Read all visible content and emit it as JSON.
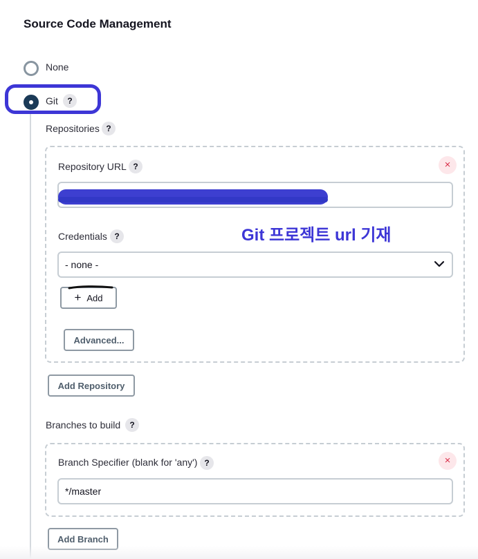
{
  "section": {
    "title": "Source Code Management"
  },
  "scm_options": {
    "none_label": "None",
    "git_label": "Git"
  },
  "help_glyph": "?",
  "repositories": {
    "label": "Repositories",
    "url_label": "Repository URL",
    "url_value": "",
    "credentials_label": "Credentials",
    "credentials_selected": "- none -",
    "add_label": "Add",
    "add_icon": "+",
    "advanced_label": "Advanced...",
    "remove_glyph": "×",
    "add_repository_label": "Add Repository"
  },
  "branches": {
    "label": "Branches to build",
    "specifier_label": "Branch Specifier (blank for 'any')",
    "specifier_value": "*/master",
    "remove_glyph": "×",
    "add_branch_label": "Add Branch"
  },
  "annotation": {
    "text": "Git 프로젝트 url 기재"
  },
  "colors": {
    "highlight": "#3d36d6",
    "radio_checked": "#1b3a57",
    "remove": "#d9304a"
  }
}
